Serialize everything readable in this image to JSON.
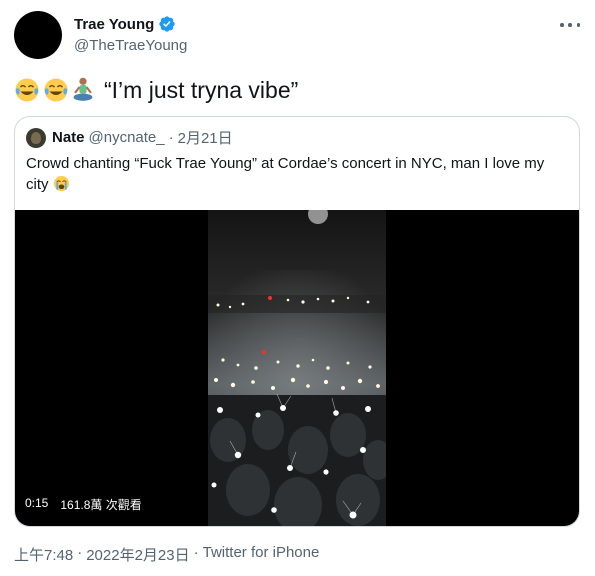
{
  "author": {
    "display_name": "Trae Young",
    "handle": "@TheTraeYoung",
    "verified_icon": "verified-badge-icon",
    "more_icon": "more-horizontal-icon"
  },
  "tweet": {
    "text": "“I’m just tryna vibe”",
    "emojis": [
      "face-with-tears-of-joy",
      "face-with-tears-of-joy",
      "person-in-lotus-position"
    ]
  },
  "quote": {
    "display_name": "Nate",
    "handle": "@nycnate_",
    "separator": "·",
    "date": "2月21日",
    "text": "Crowd chanting “Fuck Trae Young” at Cordae’s concert in NYC, man I love my city",
    "emoji": "loudly-crying-face",
    "video": {
      "duration": "0:15",
      "views": "161.8萬 次觀看"
    }
  },
  "footer": {
    "time": "上午7:48",
    "sep1": "·",
    "date": "2022年2月23日",
    "sep2": "·",
    "source": "Twitter for iPhone"
  },
  "colors": {
    "text_primary": "#0f1419",
    "text_secondary": "#536471",
    "border": "#cfd9de",
    "verified_blue": "#1d9bf0"
  }
}
